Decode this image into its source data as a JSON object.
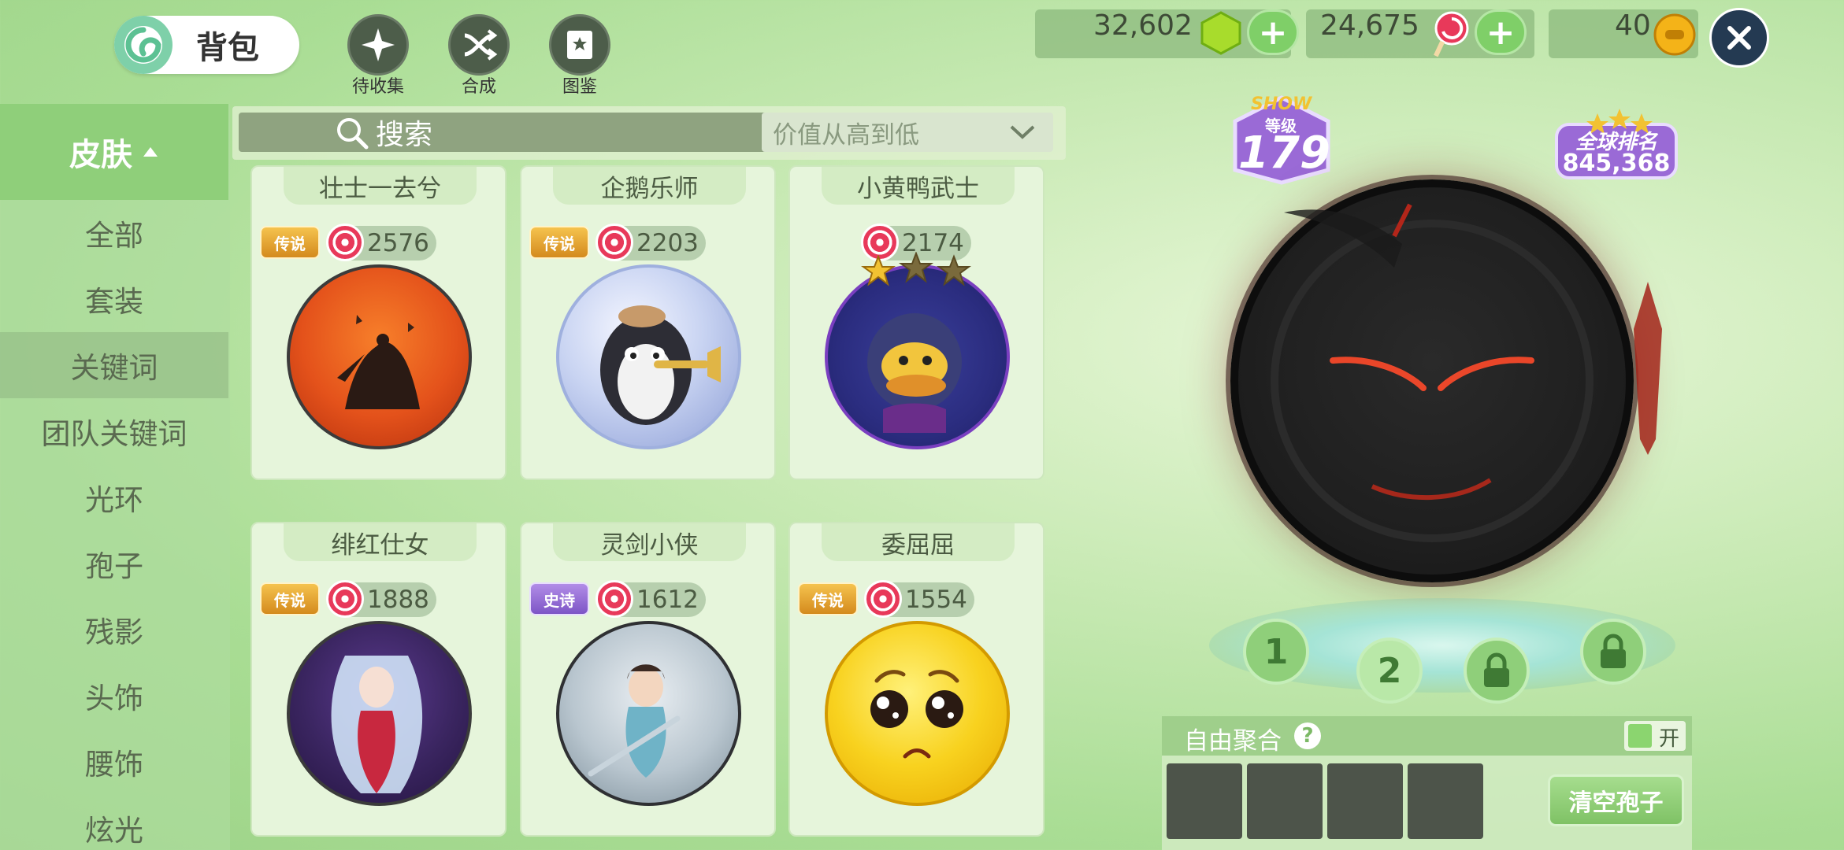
{
  "header": {
    "bag_title": "背包",
    "tools": [
      {
        "label": "待收集",
        "icon": "sparkle-icon"
      },
      {
        "label": "合成",
        "icon": "merge-arrows-icon"
      },
      {
        "label": "图鉴",
        "icon": "book-icon"
      }
    ],
    "currencies": [
      {
        "value": "32,602",
        "icon": "green-gem-icon"
      },
      {
        "value": "24,675",
        "icon": "candy-icon"
      },
      {
        "value": "40",
        "icon": "gold-coin-icon"
      }
    ],
    "plus_label": "+"
  },
  "sidebar": {
    "category": "皮肤",
    "items": [
      {
        "label": "全部",
        "active": false
      },
      {
        "label": "套装",
        "active": false
      },
      {
        "label": "关键词",
        "active": true
      },
      {
        "label": "团队关键词",
        "active": false
      },
      {
        "label": "光环",
        "active": false
      },
      {
        "label": "孢子",
        "active": false
      },
      {
        "label": "残影",
        "active": false
      },
      {
        "label": "头饰",
        "active": false
      },
      {
        "label": "腰饰",
        "active": false
      },
      {
        "label": "炫光",
        "active": false
      }
    ]
  },
  "filter": {
    "search_label": "搜索",
    "sort_label": "价值从高到低"
  },
  "cards": [
    {
      "title": "壮士一去兮",
      "rarity": "传说",
      "price": "2576"
    },
    {
      "title": "企鹅乐师",
      "rarity": "传说",
      "price": "2203"
    },
    {
      "title": "小黄鸭武士",
      "rarity": "",
      "price": "2174"
    },
    {
      "title": "绯红仕女",
      "rarity": "传说",
      "price": "1888"
    },
    {
      "title": "灵剑小侠",
      "rarity": "史诗",
      "price": "1612"
    },
    {
      "title": "委屈屈",
      "rarity": "传说",
      "price": "1554"
    }
  ],
  "showcase": {
    "show_label": "SHOW",
    "level_label": "等级",
    "level": "179",
    "rank_label": "全球排名",
    "rank": "845,368",
    "slots": [
      "1",
      "2"
    ]
  },
  "merge": {
    "title": "自由聚合",
    "help": "?",
    "toggle_label": "开",
    "toggle_on": true,
    "clear_label": "清空孢子"
  },
  "colors": {
    "accent_green": "#8fcf7a",
    "legend_gold": "#d48a1d",
    "epic_purple": "#7d55c6",
    "candy_red": "#e8395a"
  }
}
